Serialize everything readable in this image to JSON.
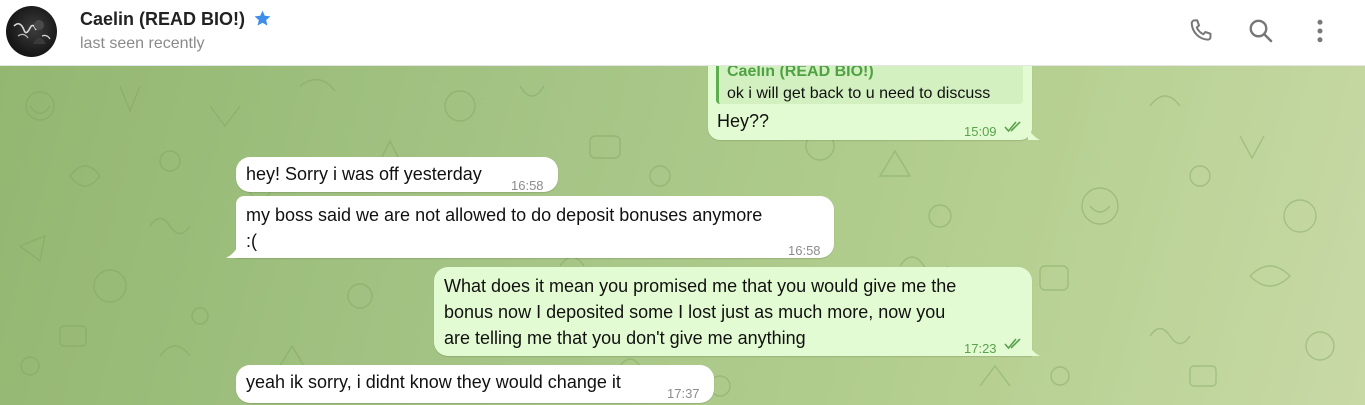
{
  "contact": {
    "name": "Caelin (READ BIO!)",
    "status": "last seen recently",
    "verified_icon": "star-icon"
  },
  "header_actions": {
    "call_icon": "phone-icon",
    "search_icon": "search-icon",
    "more_icon": "more-vertical-icon"
  },
  "messages": [
    {
      "direction": "outgoing",
      "reply_to": {
        "author": "Caelin (READ BIO!)",
        "text": "ok i will get back to u need to discuss"
      },
      "text": "Hey??",
      "time": "15:09",
      "status": "read"
    },
    {
      "direction": "incoming",
      "text": "hey! Sorry i was off yesterday",
      "time": "16:58"
    },
    {
      "direction": "incoming",
      "lines": [
        "my boss said we are not allowed to do deposit bonuses anymore",
        ":("
      ],
      "time": "16:58"
    },
    {
      "direction": "outgoing",
      "lines": [
        "What does it mean you promised me that you would give me the",
        "bonus now I deposited some I lost just as much more, now you",
        "are telling me that you don't give me anything"
      ],
      "time": "17:23",
      "status": "read"
    },
    {
      "direction": "incoming",
      "text": "yeah ik sorry, i didnt know they would change it",
      "time": "17:37"
    }
  ],
  "colors": {
    "outgoing_bubble": "#e3fbd2",
    "incoming_bubble": "#ffffff",
    "read_ticks": "#5aa24e",
    "accent_star": "#3d8ee8",
    "chat_background": "#a3c384"
  }
}
